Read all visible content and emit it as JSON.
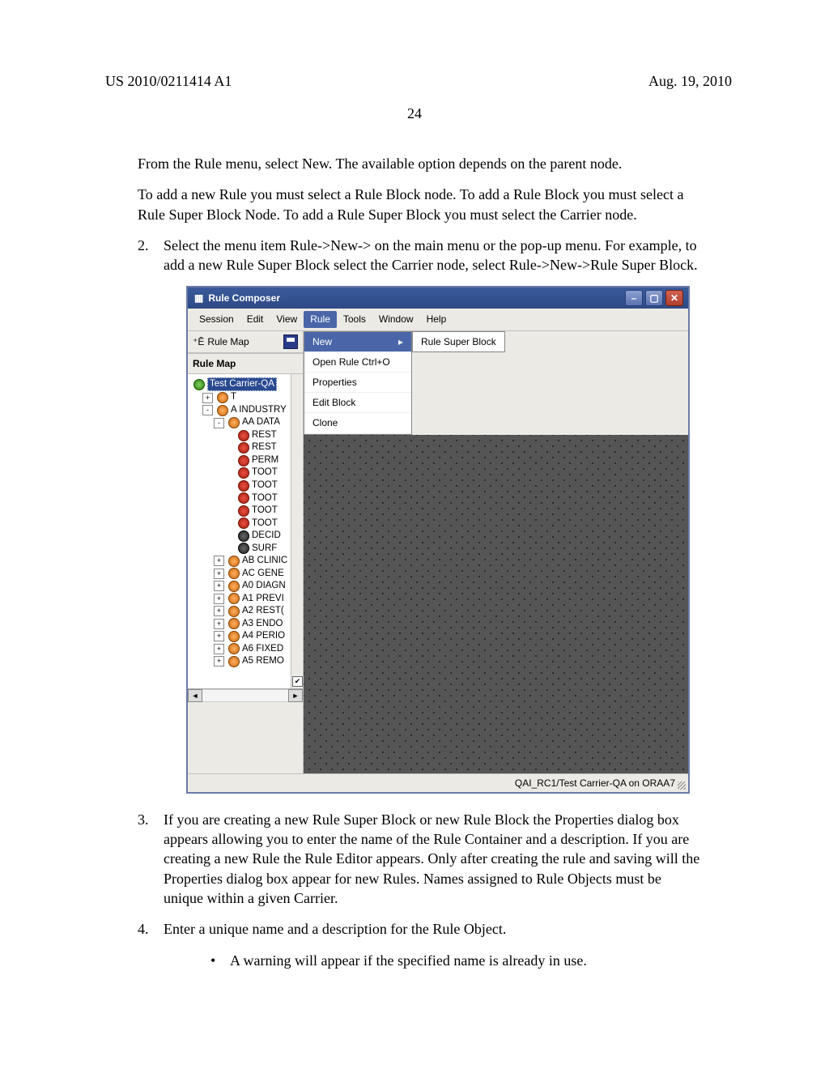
{
  "header": {
    "left_text": "US 2010/0211414 A1",
    "right_text": "Aug. 19, 2010",
    "page_number": "24"
  },
  "paragraphs": {
    "p1": "From the Rule menu, select New. The available option depends on the parent node.",
    "p2": "To add a new Rule you must select a Rule Block node. To add a Rule Block you must select a Rule Super Block Node. To add a Rule Super Block you must select the Carrier node.",
    "item2_num": "2.",
    "item2_text": "Select the menu item Rule->New-> on the main menu or the pop-up menu. For example, to add a new Rule Super Block select the Carrier node, select Rule->New->Rule Super Block.",
    "item3_num": "3.",
    "item3_text": "If you are creating a new Rule Super Block or new Rule Block the Properties dialog box appears allowing you to enter the name of the Rule Container and a description. If you are creating a new Rule the Rule Editor appears. Only after creating the rule and saving will the Properties dialog box appear for new Rules. Names assigned to Rule Objects must be unique within a given Carrier.",
    "item4_num": "4.",
    "item4_text": "Enter a unique name and a description for the Rule Object.",
    "bullet_dot": "•",
    "bullet_text": "A warning will appear if the specified name is already in use."
  },
  "app": {
    "title": "Rule Composer",
    "menubar": [
      "Session",
      "Edit",
      "View",
      "Rule",
      "Tools",
      "Window",
      "Help"
    ],
    "rule_menu": {
      "items": [
        {
          "label": "New",
          "hl": true,
          "arrow": true
        },
        {
          "label": "Open Rule   Ctrl+O"
        },
        {
          "label": "Properties"
        },
        {
          "label": "Edit Block"
        },
        {
          "label": "Clone"
        }
      ],
      "submenu": "Rule Super Block"
    },
    "sidebar": {
      "toolbar_label": "Rule Map",
      "header": "Rule Map",
      "root": "Test Carrier-QA",
      "nodes": [
        {
          "indent": 1,
          "exp": "+",
          "ic": "orange",
          "label": "T"
        },
        {
          "indent": 1,
          "exp": "-",
          "ic": "orange",
          "label": "A INDUSTRY"
        },
        {
          "indent": 2,
          "exp": "-",
          "ic": "orange",
          "label": "AA DATA"
        },
        {
          "indent": 3,
          "ic": "red",
          "label": "REST"
        },
        {
          "indent": 3,
          "ic": "red",
          "label": "REST"
        },
        {
          "indent": 3,
          "ic": "red",
          "label": "PERM"
        },
        {
          "indent": 3,
          "ic": "red",
          "label": "TOOT"
        },
        {
          "indent": 3,
          "ic": "red",
          "label": "TOOT"
        },
        {
          "indent": 3,
          "ic": "red",
          "label": "TOOT"
        },
        {
          "indent": 3,
          "ic": "red",
          "label": "TOOT"
        },
        {
          "indent": 3,
          "ic": "red",
          "label": "TOOT"
        },
        {
          "indent": 3,
          "ic": "dark",
          "label": "DECID"
        },
        {
          "indent": 3,
          "ic": "dark",
          "label": "SURF"
        },
        {
          "indent": 2,
          "exp": "+",
          "ic": "orange",
          "label": "AB CLINIC"
        },
        {
          "indent": 2,
          "exp": "+",
          "ic": "orange",
          "label": "AC GENE"
        },
        {
          "indent": 2,
          "exp": "+",
          "ic": "orange",
          "label": "A0 DIAGN"
        },
        {
          "indent": 2,
          "exp": "+",
          "ic": "orange",
          "label": "A1 PREVI"
        },
        {
          "indent": 2,
          "exp": "+",
          "ic": "orange",
          "label": "A2 REST("
        },
        {
          "indent": 2,
          "exp": "+",
          "ic": "orange",
          "label": "A3 ENDO"
        },
        {
          "indent": 2,
          "exp": "+",
          "ic": "orange",
          "label": "A4 PERIO"
        },
        {
          "indent": 2,
          "exp": "+",
          "ic": "orange",
          "label": "A6 FIXED"
        },
        {
          "indent": 2,
          "exp": "+",
          "ic": "orange",
          "label": "A5 REMO"
        }
      ]
    },
    "statusbar": "QAI_RC1/Test Carrier-QA on ORAA7"
  }
}
